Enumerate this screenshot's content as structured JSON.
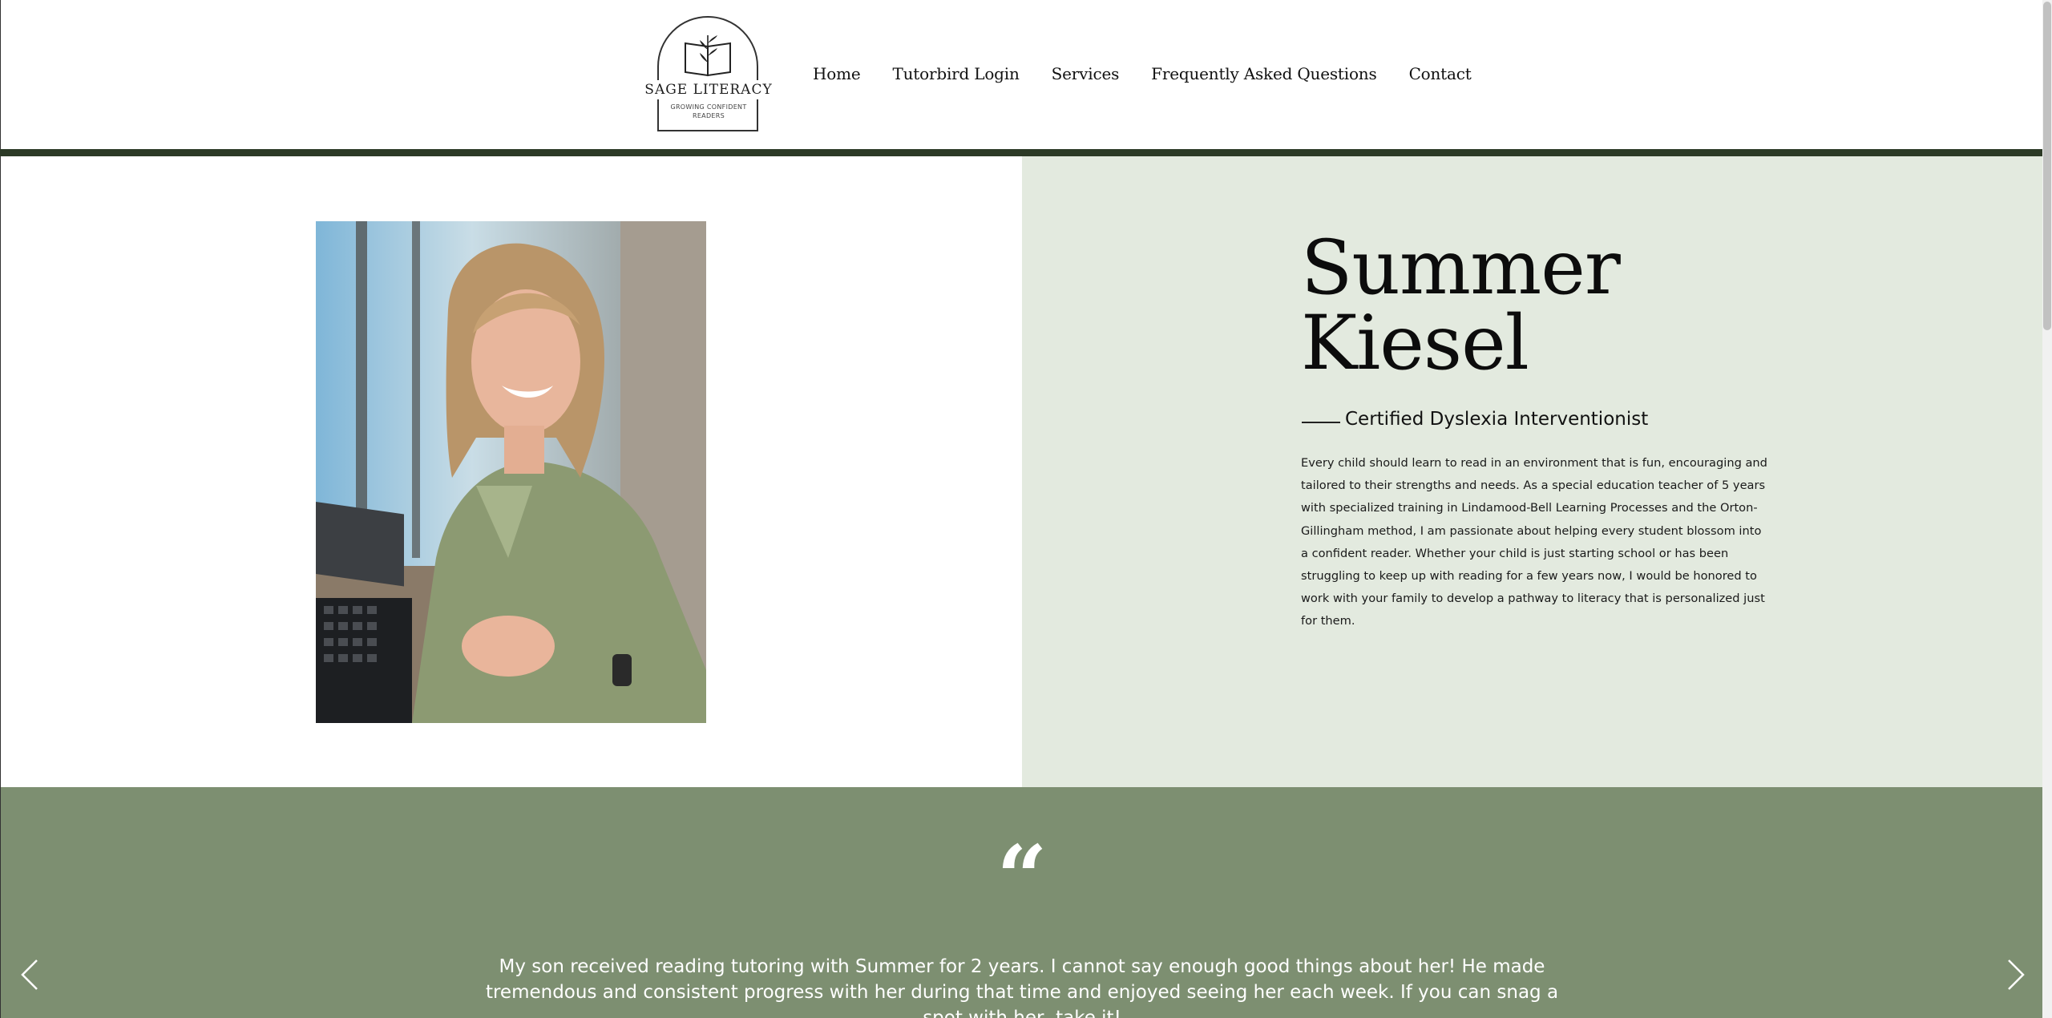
{
  "header": {
    "logo": {
      "name": "SAGE LITERACY",
      "tagline": "GROWING CONFIDENT READERS"
    },
    "nav": [
      {
        "label": "Home"
      },
      {
        "label": "Tutorbird Login"
      },
      {
        "label": "Services"
      },
      {
        "label": "Frequently Asked Questions"
      },
      {
        "label": "Contact"
      }
    ]
  },
  "hero": {
    "name_first": "Summer",
    "name_last": "Kiesel",
    "role": "Certified Dyslexia Interventionist",
    "bio": "Every child should learn to read in an environment that is fun, encouraging and tailored to their strengths and needs. As a special education teacher of 5 years with specialized training in Lindamood-Bell Learning Processes and the Orton-Gillingham method, I am passionate about helping every student blossom into a confident reader. Whether your child is just starting school or has been struggling to keep up with reading for a few years now, I would be honored to work with your family to develop a pathway to literacy that is personalized just for them."
  },
  "testimonial": {
    "quote_mark": "“",
    "text": "My son received reading tutoring with Summer for 2 years. I cannot say enough good things about her! He made tremendous and consistent progress with her during that time and enjoyed seeing her each week. If you can snag a spot with her, take it!"
  },
  "colors": {
    "header_rule": "#2c3a26",
    "hero_right_bg": "#e3eadf",
    "testimonial_bg": "#7d8f71"
  },
  "icons": {
    "prev": "chevron-left-icon",
    "next": "chevron-right-icon"
  }
}
